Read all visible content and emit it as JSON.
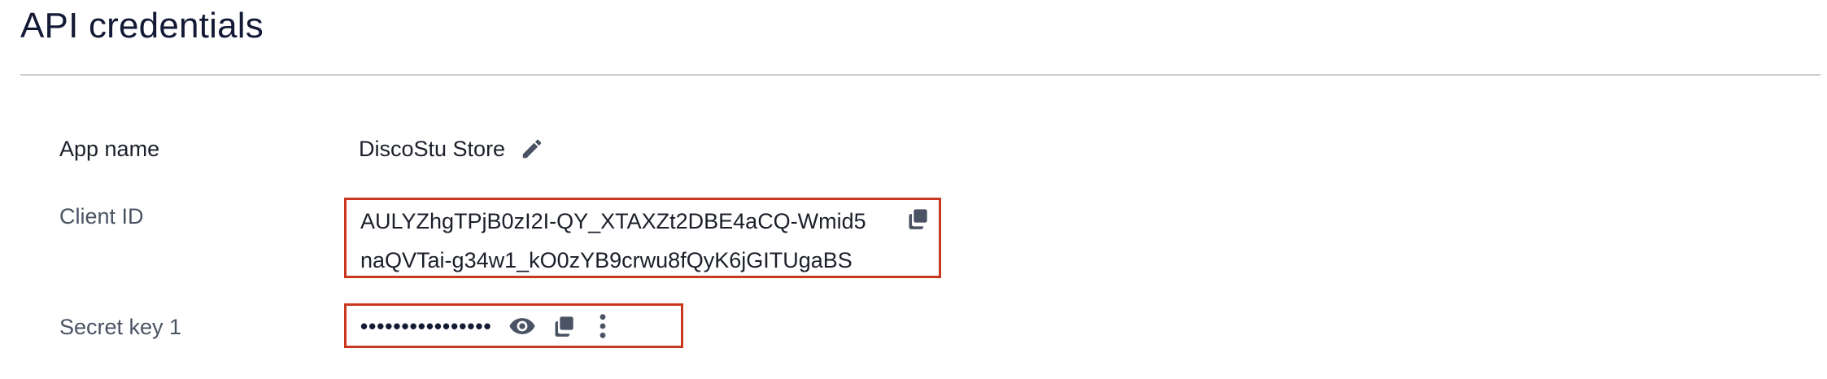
{
  "page": {
    "title": "API credentials"
  },
  "fields": {
    "app_name": {
      "label": "App name",
      "value": "DiscoStu Store",
      "edit_icon": "pencil-icon"
    },
    "client_id": {
      "label": "Client ID",
      "line1": "AULYZhgTPjB0zI2I-QY_XTAXZt2DBE4aCQ-Wmid5",
      "line2": "naQVTai-g34w1_kO0zYB9crwu8fQyK6jGITUgaBS",
      "copy_icon": "copy-icon"
    },
    "secret_key": {
      "label": "Secret key 1",
      "masked_value": "••••••••••••••••",
      "show_icon": "eye-icon",
      "copy_icon": "copy-icon",
      "more_icon": "more-vertical-icon"
    }
  },
  "colors": {
    "highlight_border": "#c9371f",
    "divider": "#c9ccd1",
    "icon": "#4a5363",
    "title": "#131a35"
  }
}
